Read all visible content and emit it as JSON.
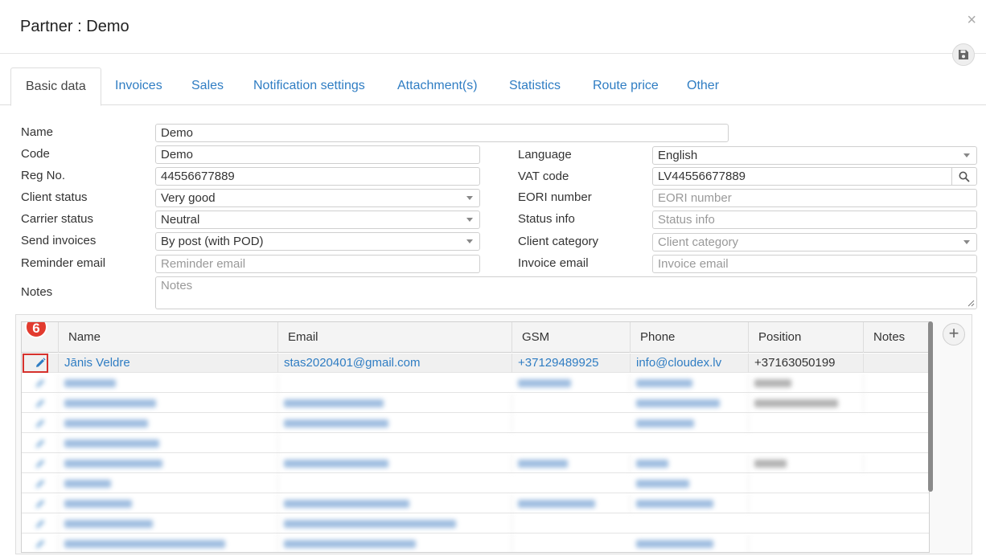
{
  "window": {
    "title": "Partner : Demo",
    "close_glyph": "×"
  },
  "tabs": [
    {
      "label": "Basic data",
      "active": true
    },
    {
      "label": "Invoices"
    },
    {
      "label": "Sales"
    },
    {
      "label": "Notification settings"
    },
    {
      "label": "Attachment(s)"
    },
    {
      "label": "Statistics"
    },
    {
      "label": "Route price"
    },
    {
      "label": "Other"
    }
  ],
  "form": {
    "name": {
      "label": "Name",
      "value": "Demo"
    },
    "code": {
      "label": "Code",
      "value": "Demo"
    },
    "reg_no": {
      "label": "Reg No.",
      "value": "44556677889"
    },
    "client_status": {
      "label": "Client status",
      "value": "Very good"
    },
    "carrier_status": {
      "label": "Carrier status",
      "value": "Neutral"
    },
    "send_invoices": {
      "label": "Send invoices",
      "value": "By post (with POD)"
    },
    "reminder_email": {
      "label": "Reminder email",
      "placeholder": "Reminder email"
    },
    "notes": {
      "label": "Notes",
      "placeholder": "Notes"
    },
    "language": {
      "label": "Language",
      "value": "English"
    },
    "vat_code": {
      "label": "VAT code",
      "value": "LV44556677889"
    },
    "eori_number": {
      "label": "EORI number",
      "placeholder": "EORI number"
    },
    "status_info": {
      "label": "Status info",
      "placeholder": "Status info"
    },
    "client_category": {
      "label": "Client category",
      "placeholder": "Client category"
    },
    "invoice_email": {
      "label": "Invoice email",
      "placeholder": "Invoice email"
    }
  },
  "contacts": {
    "columns": [
      "Name",
      "Email",
      "GSM",
      "Phone",
      "Position",
      "Notes"
    ],
    "first_row": {
      "name": "Jānis Veldre",
      "email": "stas2020401@gmail.com",
      "gsm": "+37129489925",
      "phone": "info@cloudex.lv",
      "position": "+37163050199",
      "notes": ""
    },
    "badge": "6",
    "add_glyph": "+"
  },
  "colors": {
    "link": "#2f7dc3",
    "badge": "#e23b2f"
  }
}
